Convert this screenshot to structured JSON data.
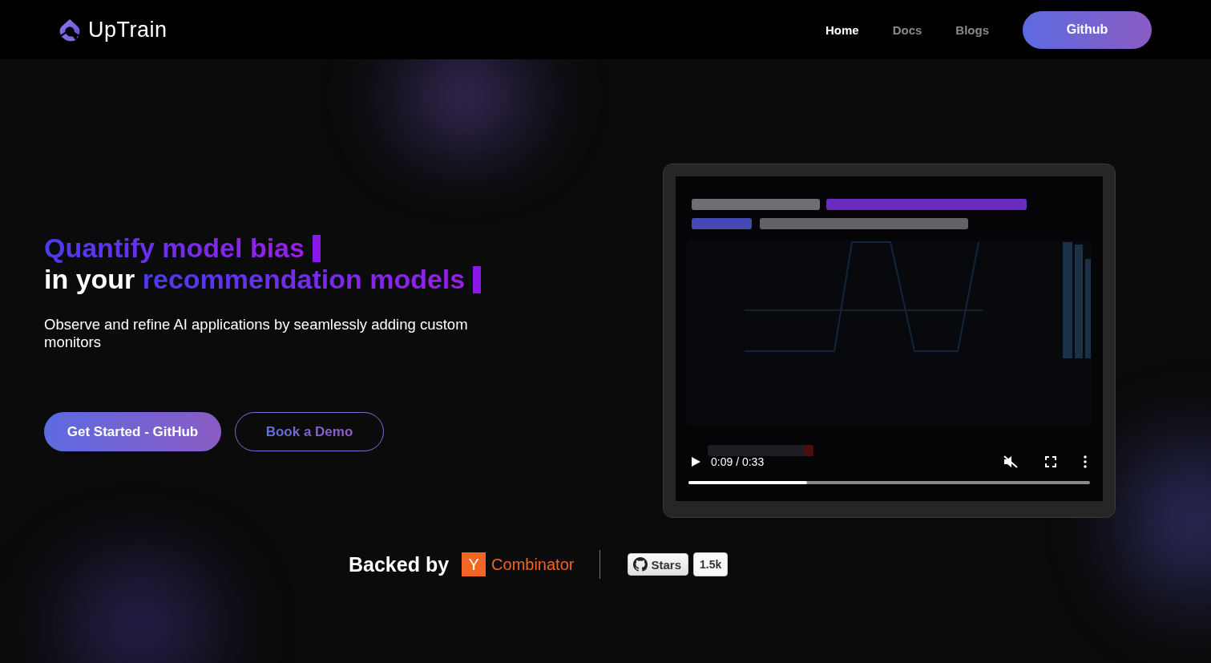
{
  "header": {
    "logo": "UpTrain",
    "nav": [
      {
        "label": "Home",
        "selected": true
      },
      {
        "label": "Docs",
        "selected": false
      },
      {
        "label": "Blogs",
        "selected": false
      }
    ],
    "cta": "Github"
  },
  "hero": {
    "headline_lines": [
      {
        "highlight": "Quantify model bias"
      },
      {
        "prefix": "in your ",
        "highlight": "recommendation models"
      }
    ],
    "subtitle": "Observe and refine AI applications by seamlessly adding custom monitors",
    "buttons": [
      {
        "label": "Get Started - GitHub",
        "kind": "primary"
      },
      {
        "label": "Book a Demo",
        "kind": "outline"
      }
    ]
  },
  "video": {
    "playing": false,
    "muted": true,
    "time": "0:09 / 0:33",
    "level": 0.295
  },
  "backed": {
    "label": "Backed by",
    "yc_mark": "Y",
    "yc_name": "Combinator"
  },
  "github_badge": {
    "label": "Stars",
    "count": "1.5k"
  }
}
